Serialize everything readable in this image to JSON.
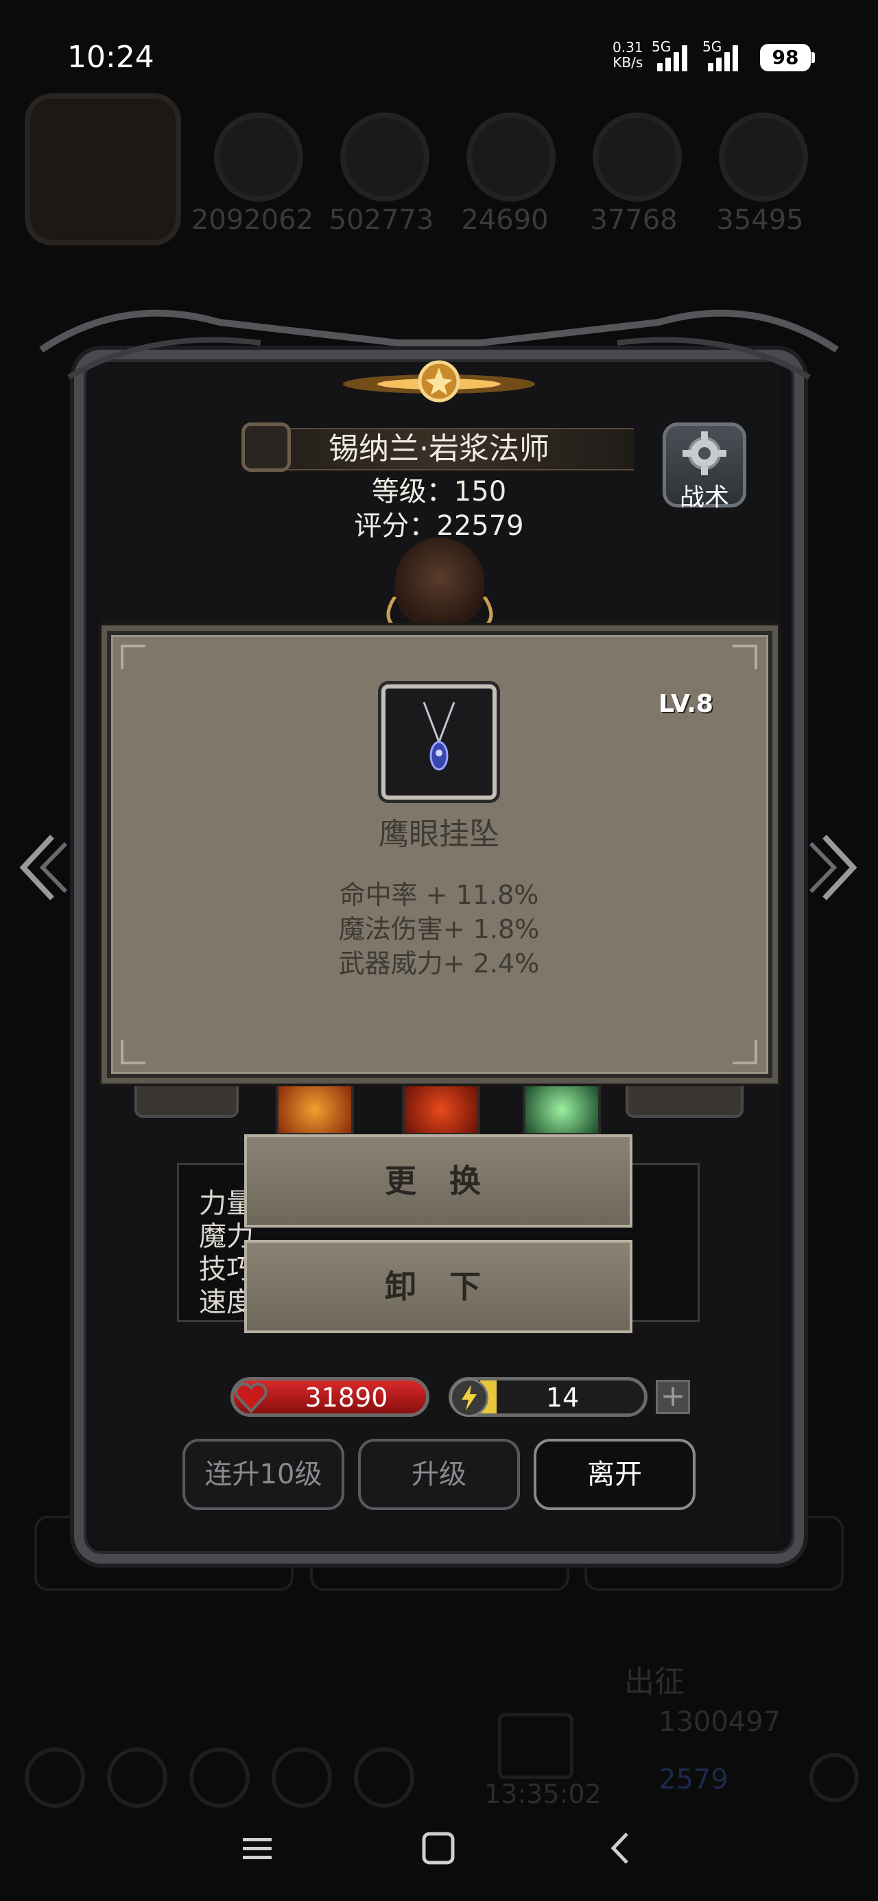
{
  "status_bar": {
    "time": "10:24",
    "net_speed_value": "0.31",
    "net_speed_unit": "KB/s",
    "network_1": "5G",
    "network_2": "5G",
    "battery": "98"
  },
  "background": {
    "resources": [
      "2092062",
      "502773",
      "24690",
      "37768",
      "35495"
    ],
    "expedition_label": "出征",
    "expedition_gold": "1300497",
    "expedition_gem": "2579",
    "timer": "13:35:02"
  },
  "hero": {
    "name": "锡纳兰·岩浆法师",
    "level": "等级：150",
    "score": "评分：22579",
    "tactics_label": "战术"
  },
  "item": {
    "level": "LV.8",
    "name": "鹰眼挂坠",
    "stats": [
      "命中率 + 11.8%",
      "魔法伤害+ 1.8%",
      "武器威力+ 2.4%"
    ]
  },
  "attributes": {
    "labels": [
      "力量",
      "魔力",
      "技巧",
      "速度"
    ]
  },
  "actions": {
    "replace_label": "更 换",
    "unequip_label": "卸 下"
  },
  "vitals": {
    "hp": "31890",
    "energy": "14",
    "energy_fraction": 0.1,
    "plus_label": "+"
  },
  "buttons": {
    "upgrade10": "连升10级",
    "upgrade": "升级",
    "leave": "离开"
  },
  "colors": {
    "popup_bg": "#7e776a",
    "hp_red": "#d82a2a",
    "energy_yellow": "#e8c83a"
  }
}
